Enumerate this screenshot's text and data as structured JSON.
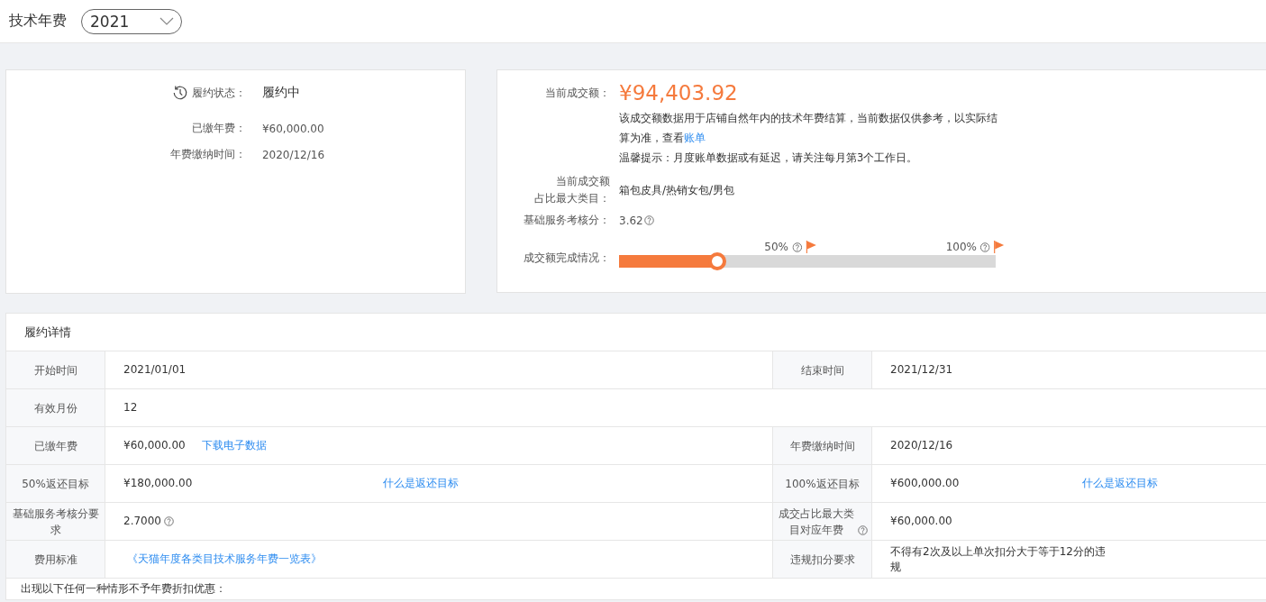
{
  "header": {
    "title": "技术年费",
    "year_select": {
      "value": "2021"
    }
  },
  "status_card": {
    "status_label": "履约状态：",
    "status_value": "履约中",
    "items": [
      {
        "label": "已缴年费：",
        "value": "¥60,000.00"
      },
      {
        "label": "年费缴纳时间：",
        "value": "2020/12/16"
      }
    ]
  },
  "sales_card": {
    "amount_label": "当前成交额：",
    "amount": "¥94,403.92",
    "note": "该成交额数据用于店铺自然年内的技术年费结算，当前数据仅供参考，以实际结算为准，查看",
    "note_link": "账单",
    "tip": "温馨提示：月度账单数据或有延迟，请关注每月第3个工作日。",
    "category_label": [
      "当前成交额",
      "占比最大类目："
    ],
    "category": "箱包皮具/热销女包/男包",
    "score_label": "基础服务考核分：",
    "score": "3.62",
    "progress_label": "成交额完成情况：",
    "level": 0.26,
    "markers": [
      {
        "label": "50%"
      },
      {
        "label": "100%"
      }
    ]
  },
  "details": {
    "title": "履约详情",
    "rows": [
      {
        "cells": [
          {
            "label": "开始时间",
            "value": "2021/01/01"
          },
          {
            "label": "结束时间",
            "value": "2021/12/31"
          }
        ]
      },
      {
        "cells": [
          {
            "label": "有效月份",
            "value": "12"
          }
        ]
      },
      {
        "cells": [
          {
            "label": "已缴年费",
            "value": "¥60,000.00",
            "link": "下载电子数据",
            "kind": "inline"
          },
          {
            "label": "年费缴纳时间",
            "value": "2020/12/16"
          }
        ]
      },
      {
        "cells": [
          {
            "label": "50%返还目标",
            "value": "¥180,000.00",
            "link": "什么是返还目标",
            "kind": "aside"
          },
          {
            "label": "100%返还目标",
            "value": "¥600,000.00",
            "link": "什么是返还目标",
            "kind": "aside"
          }
        ]
      },
      {
        "cells": [
          {
            "label": "基础服务考核分要求",
            "value": "2.7000",
            "value_help": true
          },
          {
            "label": "成交占比最大类目对应年费",
            "label_help": true,
            "value": "¥60,000.00"
          }
        ]
      },
      {
        "cells": [
          {
            "label": "费用标准",
            "link": "《天猫年度各类目技术服务年费一览表》",
            "kind": "inline"
          },
          {
            "label": "违规扣分要求",
            "value": "不得有2次及以上单次扣分大于等于12分的违规"
          }
        ]
      }
    ],
    "notice": "出现以下任何一种情形不予年费折扣优惠："
  }
}
